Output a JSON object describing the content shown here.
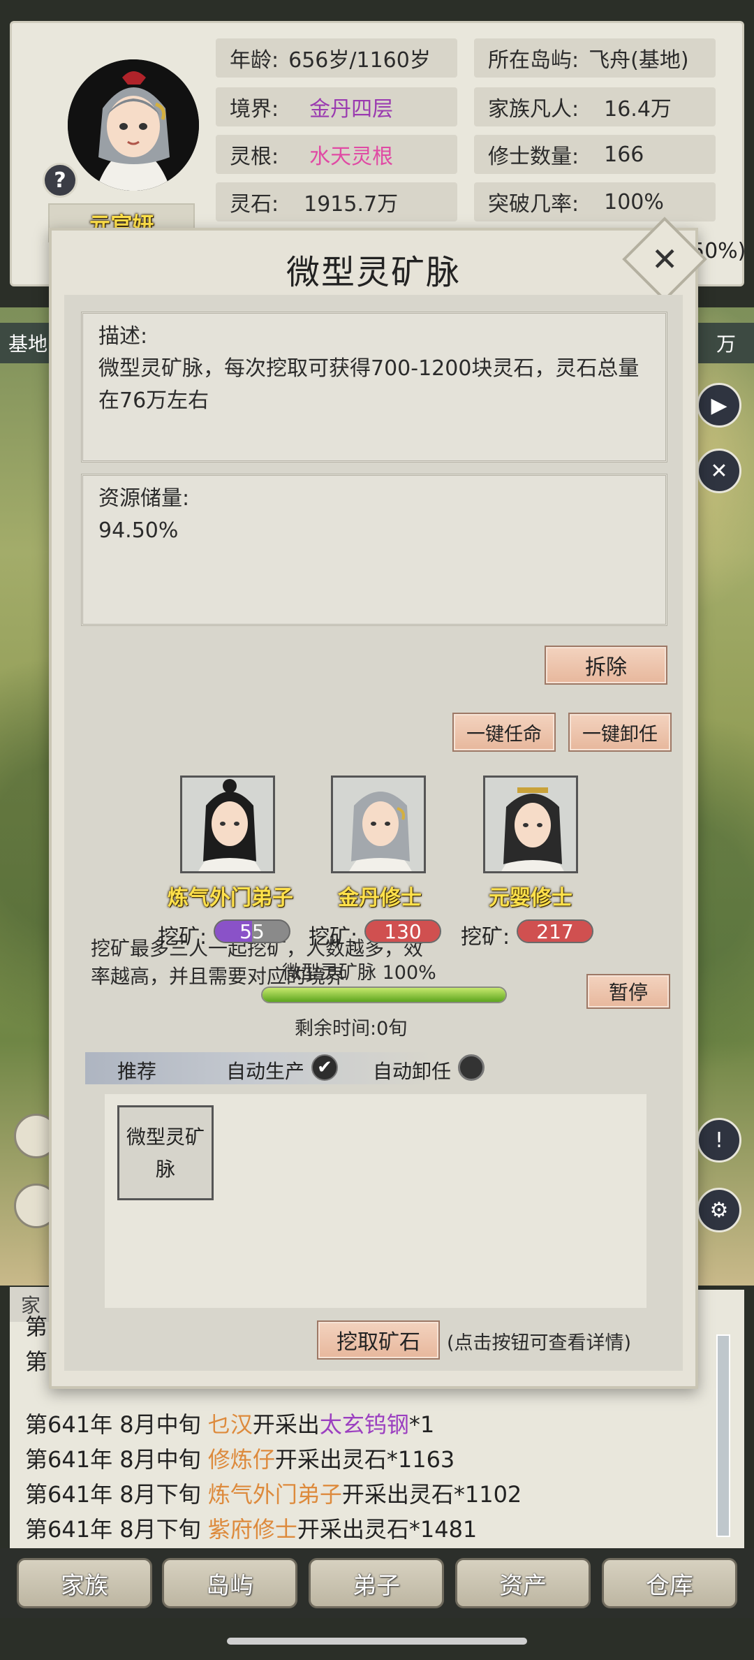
{
  "profile": {
    "name": "亓官妍",
    "help_glyph": "?",
    "age_label": "年龄:",
    "age_value": "656岁/1160岁",
    "island_label": "所在岛屿:",
    "island_value": "飞舟(基地)",
    "realm_label": "境界:",
    "realm_value": "金丹四层",
    "mortals_label": "家族凡人:",
    "mortals_value": "16.4万",
    "root_label": "灵根:",
    "root_value": "水天灵根",
    "cultivators_label": "修士数量:",
    "cultivators_value": "166",
    "stones_label": "灵石:",
    "stones_value": "1915.7万",
    "breakthrough_label": "突破几率:",
    "breakthrough_value": "100%",
    "partial_pct": "50%)"
  },
  "side": {
    "left_tag": "基地",
    "right_tag": "万"
  },
  "dialog": {
    "title": "微型灵矿脉",
    "close_glyph": "✕",
    "desc_title": "描述:",
    "desc_text": "微型灵矿脉，每次挖取可获得700-1200块灵石，灵石总量在76万左右",
    "reserve_title": "资源储量:",
    "reserve_value": "94.50%",
    "demolish_label": "拆除",
    "miner_desc": "挖矿最多三人一起挖矿，人数越多，效率越高，并且需要对应的境界",
    "appoint_all_label": "一键任命",
    "dismiss_all_label": "一键卸任",
    "mine_label": "挖矿:",
    "miners": [
      {
        "role": "炼气外门弟子",
        "value": "55",
        "level": 0.5,
        "color": "#8a52c8"
      },
      {
        "role": "金丹修士",
        "value": "130",
        "level": 1.0,
        "color": "#d05050"
      },
      {
        "role": "元婴修士",
        "value": "217",
        "level": 1.0,
        "color": "#d05050"
      }
    ],
    "progress_label": "微型灵矿脉 100%",
    "progress_value": 1.0,
    "pause_label": "暂停",
    "remaining_label": "剩余时间:0旬",
    "recommend_label": "推荐",
    "auto_produce_label": "自动生产",
    "auto_produce_checked": true,
    "auto_dismiss_label": "自动卸任",
    "auto_dismiss_checked": false,
    "recipe_card_label": "微型灵矿脉",
    "dig_button_label": "挖取矿石",
    "dig_hint": "(点击按钮可查看详情)"
  },
  "log": {
    "tab_label": "家",
    "lines": [
      {
        "prefix": "第",
        "time": "",
        "name": "",
        "name_color": "",
        "action": "",
        "item": "",
        "item_color": "",
        "suffix": ""
      },
      {
        "prefix": "第",
        "time": "",
        "name": "",
        "name_color": "",
        "action": "",
        "item": "",
        "item_color": "",
        "suffix": ""
      },
      {
        "prefix": "第641年",
        "time": "8月中旬",
        "name": "乜汉",
        "name_color": "#dd8a3c",
        "action": "开采出",
        "item": "太玄钨钢",
        "item_color": "#9b3fc0",
        "suffix": "*1"
      },
      {
        "prefix": "第641年",
        "time": "8月中旬",
        "name": "修炼仔",
        "name_color": "#dd8a3c",
        "action": "开采出灵石",
        "item": "",
        "item_color": "",
        "suffix": "*1163"
      },
      {
        "prefix": "第641年",
        "time": "8月下旬",
        "name": "炼气外门弟子",
        "name_color": "#dd8a3c",
        "action": "开采出灵石",
        "item": "",
        "item_color": "",
        "suffix": "*1102"
      },
      {
        "prefix": "第641年",
        "time": "8月下旬",
        "name": "紫府修士",
        "name_color": "#dd8a3c",
        "action": "开采出灵石",
        "item": "",
        "item_color": "",
        "suffix": "*1481"
      }
    ]
  },
  "nav": {
    "items": [
      "家族",
      "岛屿",
      "弟子",
      "资产",
      "仓库"
    ]
  }
}
